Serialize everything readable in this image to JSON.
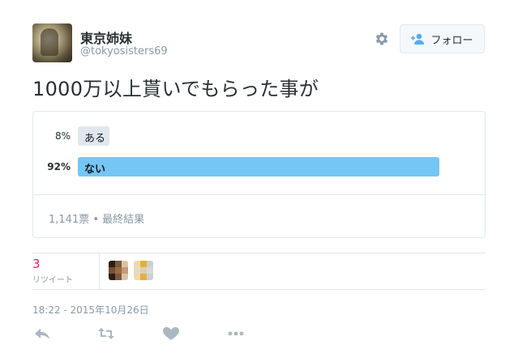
{
  "user": {
    "display_name": "東京姉妹",
    "handle": "@tokyosisters69"
  },
  "follow_button": {
    "label": "フォロー"
  },
  "tweet": {
    "text": "1000万以上貰いでもらった事が"
  },
  "poll": {
    "options": [
      {
        "percent_label": "8%",
        "label": "ある",
        "fraction": 0.08
      },
      {
        "percent_label": "92%",
        "label": "ない",
        "fraction": 0.92
      }
    ],
    "meta": "1,141票 • 最終結果"
  },
  "stats": {
    "retweet_count": "3",
    "retweet_label": "リツイート"
  },
  "timestamp": "18:22 - 2015年10月26日",
  "colors": {
    "winner_bar": "#75c5f5",
    "loser_bar": "#e1e8ed",
    "retweet_count": "#e0245e",
    "muted": "#8899a6"
  },
  "icons": {
    "settings": "gear-icon",
    "follow": "person-add-icon",
    "reply": "reply-icon",
    "retweet": "retweet-icon",
    "like": "heart-icon",
    "more": "more-icon"
  }
}
